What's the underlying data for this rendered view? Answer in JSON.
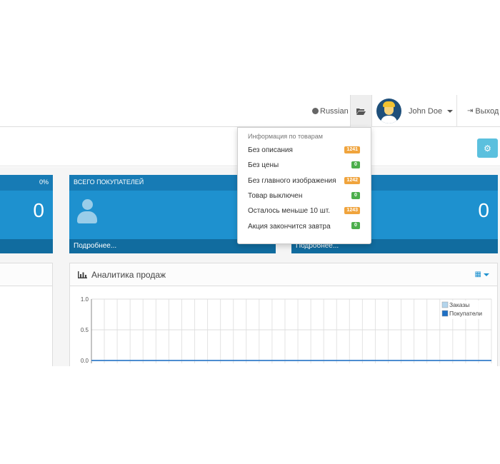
{
  "header": {
    "language": "Russian",
    "user_name": "John Doe",
    "logout": "Выход"
  },
  "tiles": [
    {
      "title": "",
      "percent": "0%",
      "value": "0",
      "footer": ""
    },
    {
      "title": "ВСЕГО ПОКУПАТЕЛЕЙ",
      "value": "",
      "footer": "Подробнее..."
    },
    {
      "title": "",
      "value": "0",
      "footer": "Подробнее..."
    }
  ],
  "analytics": {
    "title": "Аналитика продаж"
  },
  "chart_data": {
    "type": "line",
    "series": [
      {
        "name": "Заказы",
        "values": [
          0,
          0,
          0,
          0,
          0,
          0,
          0,
          0,
          0,
          0,
          0,
          0,
          0,
          0,
          0,
          0,
          0,
          0,
          0,
          0,
          0,
          0,
          0,
          0,
          0,
          0,
          0,
          0,
          0,
          0,
          0,
          0
        ],
        "color": "#b3d4ec"
      },
      {
        "name": "Покупатели",
        "values": [
          0,
          0,
          0,
          0,
          0,
          0,
          0,
          0,
          0,
          0,
          0,
          0,
          0,
          0,
          0,
          0,
          0,
          0,
          0,
          0,
          0,
          0,
          0,
          0,
          0,
          0,
          0,
          0,
          0,
          0,
          0,
          0
        ],
        "color": "#1e6fc4"
      }
    ],
    "ylim": [
      0,
      1.0
    ],
    "yticks": [
      "1.0",
      "0.5",
      "0.0"
    ],
    "grid": true,
    "legend": "top-right"
  },
  "dropdown": {
    "header": "Информация по товарам",
    "items": [
      {
        "label": "Без описания",
        "count": "1241",
        "status": "warn"
      },
      {
        "label": "Без цены",
        "count": "0",
        "status": "ok"
      },
      {
        "label": "Без главного изображения",
        "count": "1242",
        "status": "warn"
      },
      {
        "label": "Товар выключен",
        "count": "0",
        "status": "ok"
      },
      {
        "label": "Осталось меньше 10 шт.",
        "count": "1243",
        "status": "warn"
      },
      {
        "label": "Акция закончится завтра",
        "count": "0",
        "status": "ok"
      }
    ]
  },
  "colors": {
    "tile": "#1e91cf",
    "settings_button": "#5bc0de",
    "badge_warning": "#f0a43d",
    "badge_success": "#4cae4c"
  },
  "icons": {
    "language": "globe-icon",
    "notifications": "folder-open-icon",
    "logout": "sign-out-icon",
    "settings": "gear-icon",
    "customers": "user-icon",
    "analytics": "bar-chart-icon",
    "range": "calendar-icon"
  }
}
